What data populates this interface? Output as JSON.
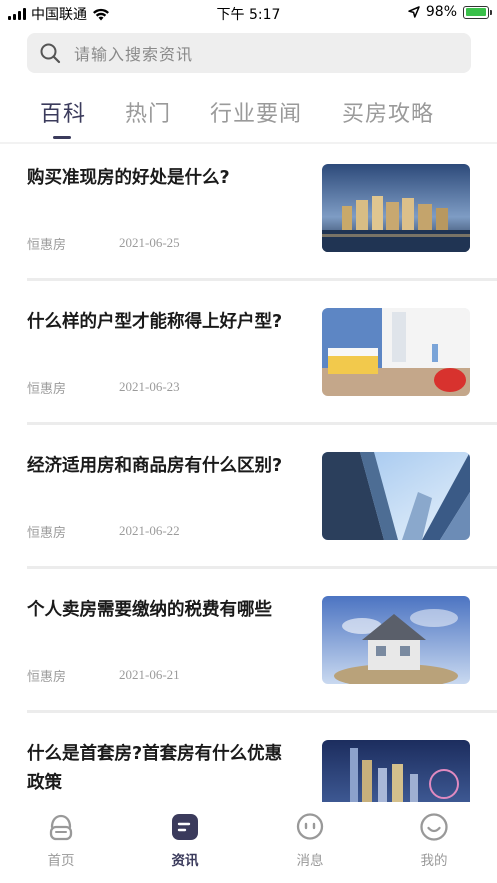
{
  "status_bar": {
    "carrier": "中国联通",
    "time": "下午 5:17",
    "battery": "98%",
    "battery_level": 0.98,
    "icons": [
      "signal-icon",
      "wifi-icon",
      "location-arrow-icon",
      "battery-icon"
    ]
  },
  "search": {
    "placeholder": "请输入搜索资讯",
    "icon": "search-icon"
  },
  "tabs": [
    {
      "label": "百科",
      "active": true
    },
    {
      "label": "热门",
      "active": false
    },
    {
      "label": "行业要闻",
      "active": false
    },
    {
      "label": "买房攻略",
      "active": false
    }
  ],
  "articles": [
    {
      "title": "购买准现房的好处是什么?",
      "source": "恒惠房",
      "date": "2021-06-25",
      "image": "city-skyline-night-photo"
    },
    {
      "title": "什么样的户型才能称得上好户型?",
      "source": "恒惠房",
      "date": "2021-06-23",
      "image": "kids-bedroom-interior-photo"
    },
    {
      "title": "经济适用房和商品房有什么区别?",
      "source": "恒惠房",
      "date": "2021-06-22",
      "image": "skyscrapers-upward-photo"
    },
    {
      "title": "个人卖房需要缴纳的税费有哪些",
      "source": "恒惠房",
      "date": "2021-06-21",
      "image": "house-on-coins-photo"
    },
    {
      "title": "什么是首套房?首套房有什么优惠政策",
      "source": "",
      "date": "",
      "image": "city-waterfront-night-photo"
    }
  ],
  "bottom_nav": [
    {
      "label": "首页",
      "icon": "home-icon",
      "active": false
    },
    {
      "label": "资讯",
      "icon": "news-icon",
      "active": true
    },
    {
      "label": "消息",
      "icon": "message-icon",
      "active": false
    },
    {
      "label": "我的",
      "icon": "profile-smile-icon",
      "active": false
    }
  ],
  "colors": {
    "accent": "#3b3b5c",
    "inactive": "#999999",
    "search_bg": "#eeeeee",
    "battery_green": "#3ac04a"
  }
}
